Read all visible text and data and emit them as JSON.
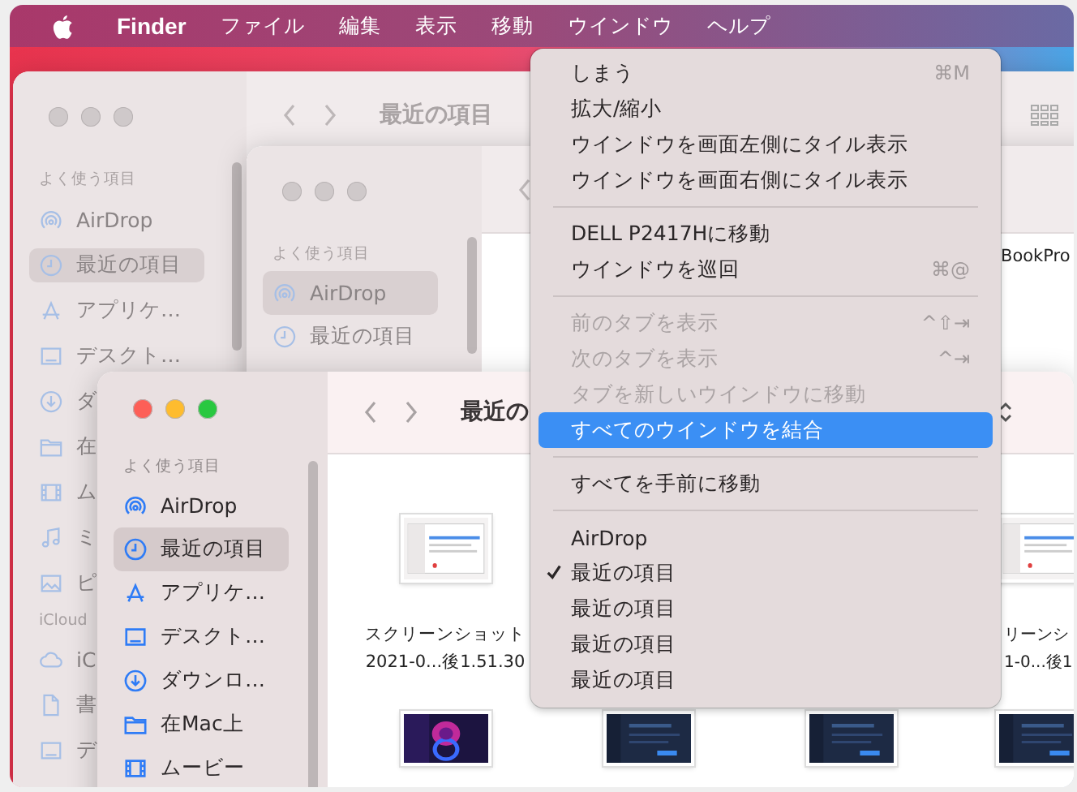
{
  "menu_bar": {
    "items": [
      {
        "label": "Finder",
        "kind": "app"
      },
      {
        "label": "ファイル",
        "kind": "menu"
      },
      {
        "label": "編集",
        "kind": "menu"
      },
      {
        "label": "表示",
        "kind": "menu"
      },
      {
        "label": "移動",
        "kind": "menu"
      },
      {
        "label": "ウインドウ",
        "kind": "menu"
      },
      {
        "label": "ヘルプ",
        "kind": "menu"
      }
    ]
  },
  "windows": [
    {
      "active": false,
      "title": "最近の項目",
      "sidebar": [
        {
          "heading": "よく使う項目",
          "items": [
            {
              "label": "AirDrop",
              "kind": "airdrop",
              "selected": false
            },
            {
              "label": "最近の項目",
              "kind": "recents",
              "selected": true
            },
            {
              "label": "アプリケ…",
              "kind": "applications",
              "selected": false
            },
            {
              "label": "デスクト…",
              "kind": "desktop",
              "selected": false
            },
            {
              "label": "ダ",
              "kind": "downloads",
              "selected": false
            },
            {
              "label": "在",
              "kind": "folder",
              "selected": false
            },
            {
              "label": "ム",
              "kind": "movies",
              "selected": false
            },
            {
              "label": "ミ",
              "kind": "music",
              "selected": false
            },
            {
              "label": "ピ",
              "kind": "pictures",
              "selected": false
            }
          ]
        },
        {
          "heading": "iCloud",
          "items": [
            {
              "label": "iC",
              "kind": "cloud",
              "selected": false
            },
            {
              "label": "書",
              "kind": "document",
              "selected": false
            },
            {
              "label": "デ",
              "kind": "desktop",
              "selected": false
            }
          ]
        }
      ]
    },
    {
      "active": false,
      "content_text": "BookPro",
      "sidebar": [
        {
          "heading": "よく使う項目",
          "items": [
            {
              "label": "AirDrop",
              "kind": "airdrop",
              "selected": true
            },
            {
              "label": "最近の項目",
              "kind": "recents",
              "selected": false
            }
          ]
        }
      ]
    },
    {
      "active": true,
      "title": "最近の",
      "sidebar": [
        {
          "heading": "よく使う項目",
          "items": [
            {
              "label": "AirDrop",
              "kind": "airdrop",
              "selected": false
            },
            {
              "label": "最近の項目",
              "kind": "recents",
              "selected": true
            },
            {
              "label": "アプリケ…",
              "kind": "applications",
              "selected": false
            },
            {
              "label": "デスクト…",
              "kind": "desktop",
              "selected": false
            },
            {
              "label": "ダウンロ…",
              "kind": "downloads",
              "selected": false
            },
            {
              "label": "在Mac上",
              "kind": "folder",
              "selected": false
            },
            {
              "label": "ムービー",
              "kind": "movies",
              "selected": false
            }
          ]
        }
      ],
      "files": [
        {
          "kind": "file",
          "name": [
            "スクリーンショット",
            "2021-0...後1.51.30"
          ]
        },
        {
          "kind": "covered"
        },
        {
          "kind": "covered"
        },
        {
          "kind": "file",
          "name": [
            "リーンシ",
            "1-0...後1"
          ]
        },
        {
          "kind": "file"
        },
        {
          "kind": "file"
        },
        {
          "kind": "file"
        },
        {
          "kind": "file"
        }
      ]
    }
  ],
  "window_menu": {
    "items": [
      {
        "kind": "item",
        "label": "しまう",
        "shortcut": "⌘M",
        "disabled": false,
        "selected": false,
        "checked": false
      },
      {
        "kind": "item",
        "label": "拡大/縮小",
        "disabled": false,
        "selected": false,
        "checked": false
      },
      {
        "kind": "item",
        "label": "ウインドウを画面左側にタイル表示",
        "disabled": false,
        "selected": false,
        "checked": false
      },
      {
        "kind": "item",
        "label": "ウインドウを画面右側にタイル表示",
        "disabled": false,
        "selected": false,
        "checked": false
      },
      {
        "kind": "separator"
      },
      {
        "kind": "item",
        "label": "DELL P2417Hに移動",
        "disabled": false,
        "selected": false,
        "checked": false
      },
      {
        "kind": "item",
        "label": "ウインドウを巡回",
        "shortcut": "⌘@",
        "disabled": false,
        "selected": false,
        "checked": false
      },
      {
        "kind": "separator"
      },
      {
        "kind": "item",
        "label": "前のタブを表示",
        "shortcut": "^⇧⇥",
        "disabled": true,
        "selected": false,
        "checked": false
      },
      {
        "kind": "item",
        "label": "次のタブを表示",
        "shortcut": "^⇥",
        "disabled": true,
        "selected": false,
        "checked": false
      },
      {
        "kind": "item",
        "label": "タブを新しいウインドウに移動",
        "disabled": true,
        "selected": false,
        "checked": false
      },
      {
        "kind": "item",
        "label": "すべてのウインドウを結合",
        "disabled": false,
        "selected": true,
        "checked": false
      },
      {
        "kind": "separator"
      },
      {
        "kind": "item",
        "label": "すべてを手前に移動",
        "disabled": false,
        "selected": false,
        "checked": false
      },
      {
        "kind": "separator"
      },
      {
        "kind": "item",
        "label": "AirDrop",
        "disabled": false,
        "selected": false,
        "checked": false
      },
      {
        "kind": "item",
        "label": "最近の項目",
        "disabled": false,
        "selected": false,
        "checked": true
      },
      {
        "kind": "item",
        "label": "最近の項目",
        "disabled": false,
        "selected": false,
        "checked": false
      },
      {
        "kind": "item",
        "label": "最近の項目",
        "disabled": false,
        "selected": false,
        "checked": false
      },
      {
        "kind": "item",
        "label": "最近の項目",
        "disabled": false,
        "selected": false,
        "checked": false
      }
    ]
  }
}
